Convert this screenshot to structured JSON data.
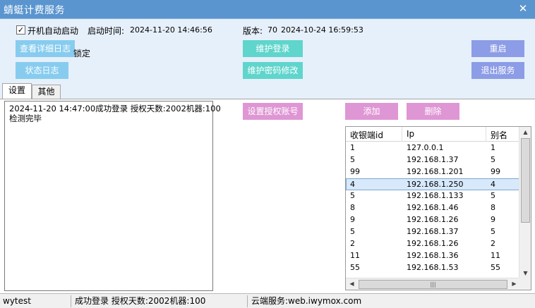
{
  "window": {
    "title": "蜻蜓计费服务"
  },
  "top": {
    "autostart_checked": "✓",
    "autostart_label": "开机自动启动",
    "start_time_label": "启动时间:",
    "start_time_value": "2024-11-20 14:46:56",
    "version_label": "版本:",
    "version_value": "70",
    "version_date": "2024-10-24 16:59:53",
    "btn_view_log": "查看详细日志",
    "btn_maintain_login": "维护登录",
    "btn_restart": "重启",
    "btn_status_log": "状态日志",
    "lock_text": "锁定",
    "btn_maintain_password": "维护密码修改",
    "btn_exit": "退出服务"
  },
  "tabs": [
    {
      "label": "设置"
    },
    {
      "label": "其他"
    }
  ],
  "log": [
    "2024-11-20 14:47:00成功登录 授权天数:2002机器:100",
    "检测完毕"
  ],
  "main": {
    "btn_set_account": "设置授权账号",
    "btn_add": "添加",
    "btn_delete": "删除"
  },
  "table": {
    "columns": [
      "收银端id",
      "Ip",
      "别名"
    ],
    "rows": [
      [
        "1",
        "127.0.0.1",
        "1"
      ],
      [
        "5",
        "192.168.1.37",
        "5"
      ],
      [
        "99",
        "192.168.1.201",
        "99"
      ],
      [
        "4",
        "192.168.1.250",
        "4"
      ],
      [
        "5",
        "192.168.1.133",
        "5"
      ],
      [
        "8",
        "192.168.1.46",
        "8"
      ],
      [
        "9",
        "192.168.1.26",
        "9"
      ],
      [
        "5",
        "192.168.1.37",
        "5"
      ],
      [
        "2",
        "192.168.1.26",
        "2"
      ],
      [
        "11",
        "192.168.1.36",
        "11"
      ],
      [
        "55",
        "192.168.1.53",
        "55"
      ]
    ],
    "selected_row": 3
  },
  "status": {
    "user": "wytest",
    "message": "成功登录 授权天数:2002机器:100",
    "cloud": "云端服务:web.iwymox.com"
  },
  "colors": {
    "titlebar": "#5a95cf",
    "button_blue": "#87ccef",
    "button_teal": "#5fd5cc",
    "button_violet": "#8c9ce6",
    "button_pink": "#df96d4"
  },
  "icons": {
    "close": "close-icon",
    "scroll_up": "arrow-up-icon",
    "scroll_down": "arrow-down-icon",
    "scroll_left": "arrow-left-icon",
    "scroll_right": "arrow-right-icon"
  }
}
